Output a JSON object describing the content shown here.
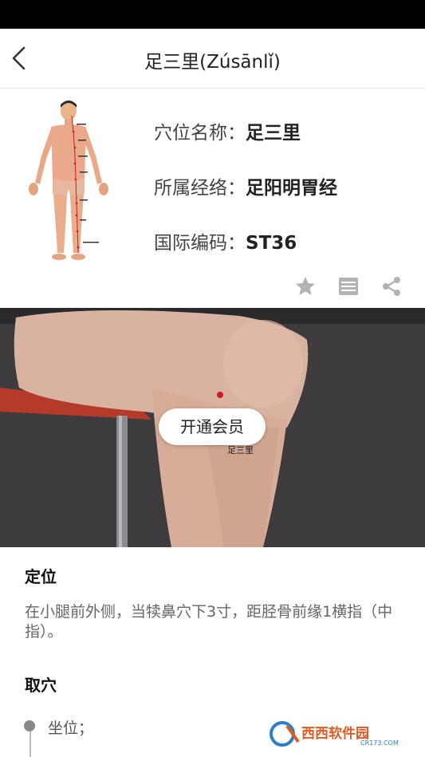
{
  "header": {
    "title": "足三里(Zúsānlǐ)"
  },
  "info": {
    "name_label": "穴位名称：",
    "name_value": "足三里",
    "meridian_label": "所属经络：",
    "meridian_value": "足阳明胃经",
    "code_label": "国际编码：",
    "code_value": "ST36"
  },
  "photo": {
    "vip_label": "开通会员",
    "point_label": "足三里"
  },
  "content": {
    "location_title": "定位",
    "location_text": "在小腿前外侧，当犊鼻穴下3寸，距胫骨前缘1横指（中指）。",
    "method_title": "取穴",
    "method_steps": [
      "坐位；"
    ]
  },
  "watermark": {
    "text": "西西软件园",
    "sub": "CR173.COM"
  },
  "colors": {
    "accent_red": "#d11a1a",
    "icon_gray": "#b3b3b3"
  }
}
